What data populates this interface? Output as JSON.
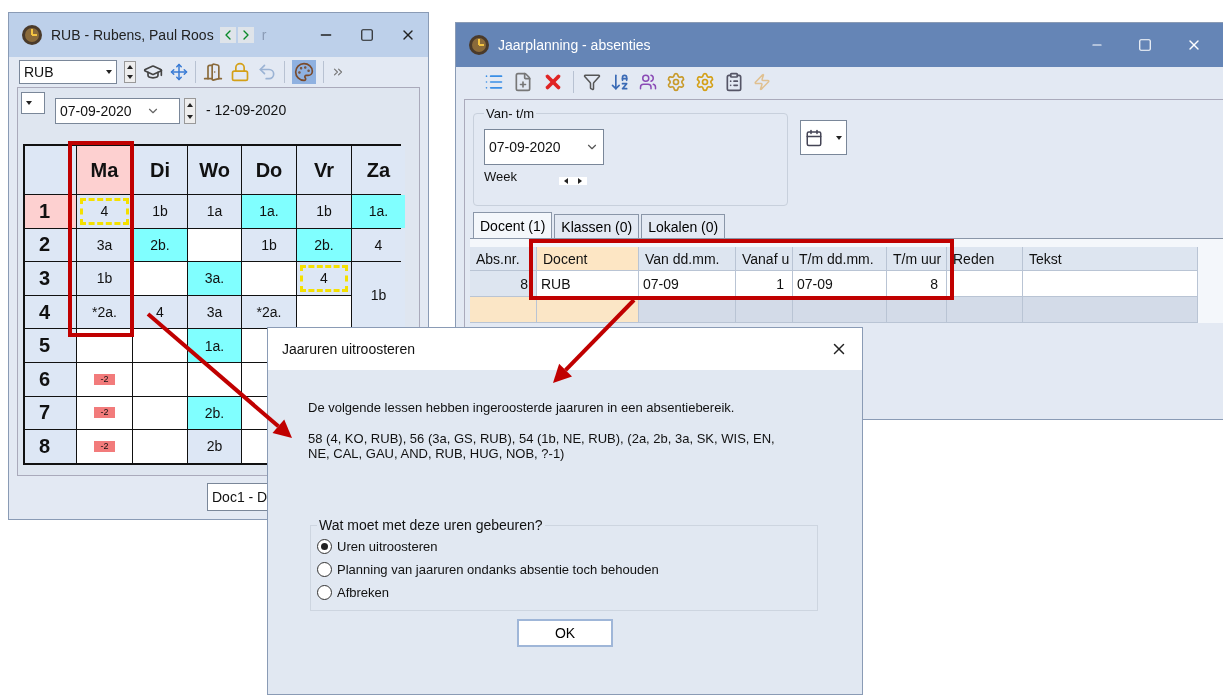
{
  "left_window": {
    "title": "RUB - Rubens, Paul  Roos",
    "title_tail": "r",
    "teacher": "RUB",
    "palette_active": true,
    "date_from": "07-09-2020",
    "date_to": "- 12-09-2020",
    "days": [
      {
        "label": "Ma",
        "selected": true
      },
      {
        "label": "Di",
        "selected": false
      },
      {
        "label": "Wo",
        "selected": false
      },
      {
        "label": "Do",
        "selected": false
      },
      {
        "label": "Vr",
        "selected": false
      },
      {
        "label": "Za",
        "selected": false
      }
    ],
    "periods": [
      {
        "label": "1",
        "selected": true,
        "cells": [
          {
            "kind": "lesson",
            "text": "4",
            "color": "#dde7f5",
            "marked": true
          },
          {
            "kind": "lesson",
            "text": "1b",
            "color": "#dde7f5",
            "marked": false
          },
          {
            "kind": "lesson",
            "text": "1a",
            "color": "#dde7f5",
            "marked": false
          },
          {
            "kind": "lesson",
            "text": "1a.",
            "color": "#80ffff",
            "marked": false
          },
          {
            "kind": "lesson",
            "text": "1b",
            "color": "#dde7f5",
            "marked": false
          },
          {
            "kind": "lesson",
            "text": "1a.",
            "color": "#80ffff",
            "marked": false
          }
        ]
      },
      {
        "label": "2",
        "selected": false,
        "cells": [
          {
            "kind": "lesson",
            "text": "3a",
            "color": "#dde7f5",
            "marked": false
          },
          {
            "kind": "lesson",
            "text": "2b.",
            "color": "#80ffff",
            "marked": false
          },
          {
            "kind": "empty",
            "marked": false
          },
          {
            "kind": "lesson",
            "text": "1b",
            "color": "#dde7f5",
            "marked": false
          },
          {
            "kind": "lesson",
            "text": "2b.",
            "color": "#80ffff",
            "marked": false
          },
          {
            "kind": "lesson",
            "text": "4",
            "color": "#dde7f5",
            "marked": false
          }
        ]
      },
      {
        "label": "3",
        "selected": false,
        "cells": [
          {
            "kind": "lesson",
            "text": "1b",
            "color": "#dde7f5",
            "marked": false
          },
          {
            "kind": "empty",
            "marked": false
          },
          {
            "kind": "lesson",
            "text": "3a.",
            "color": "#80ffff",
            "marked": false
          },
          {
            "kind": "empty",
            "marked": false
          },
          {
            "kind": "lesson",
            "text": "4",
            "color": "#dde7f5",
            "marked": true
          },
          {
            "kind": "double",
            "text": "1b",
            "color": "#dde7f5",
            "marked": false
          }
        ]
      },
      {
        "label": "4",
        "selected": false,
        "cells": [
          {
            "kind": "lesson",
            "text": "*2a.",
            "color": "#dde7f5",
            "marked": false
          },
          {
            "kind": "lesson",
            "text": "4",
            "color": "#dde7f5",
            "marked": false
          },
          {
            "kind": "lesson",
            "text": "3a",
            "color": "#dde7f5",
            "marked": false
          },
          {
            "kind": "lesson",
            "text": "*2a.",
            "color": "#dde7f5",
            "marked": false
          },
          {
            "kind": "empty",
            "marked": false
          }
        ]
      },
      {
        "label": "5",
        "selected": false,
        "cells": [
          {
            "kind": "empty",
            "marked": false
          },
          {
            "kind": "empty",
            "marked": false
          },
          {
            "kind": "lesson",
            "text": "1a.",
            "color": "#80ffff",
            "marked": false
          },
          {
            "kind": "empty",
            "marked": false
          }
        ]
      },
      {
        "label": "6",
        "selected": false,
        "cells": [
          {
            "kind": "cancel",
            "text": "-2",
            "marked": false
          },
          {
            "kind": "empty",
            "marked": false
          },
          {
            "kind": "empty",
            "marked": false
          },
          {
            "kind": "empty",
            "marked": false
          }
        ]
      },
      {
        "label": "7",
        "selected": false,
        "cells": [
          {
            "kind": "cancel",
            "text": "-2",
            "marked": false
          },
          {
            "kind": "empty",
            "marked": false
          },
          {
            "kind": "lesson",
            "text": "2b.",
            "color": "#80ffff",
            "marked": false
          },
          {
            "kind": "empty",
            "marked": false
          }
        ]
      },
      {
        "label": "8",
        "selected": false,
        "cells": [
          {
            "kind": "cancel",
            "text": "-2",
            "marked": false
          },
          {
            "kind": "empty",
            "marked": false
          },
          {
            "kind": "lesson",
            "text": "2b",
            "color": "#dde7f5",
            "marked": false
          },
          {
            "kind": "empty",
            "marked": false
          }
        ]
      }
    ],
    "footer_field": "Doc1 - D"
  },
  "right_window": {
    "title": "Jaarplanning - absenties",
    "range_group": "Van- t/m",
    "date": "07-09-2020",
    "week_label": "Week",
    "tabs": [
      {
        "label": "Docent (1)",
        "selected": true
      },
      {
        "label": "Klassen (0)",
        "selected": false
      },
      {
        "label": "Lokalen (0)",
        "selected": false
      }
    ],
    "columns": [
      {
        "label": "Abs.nr.",
        "numeric": true,
        "selected": false
      },
      {
        "label": "Docent",
        "numeric": false,
        "selected": true
      },
      {
        "label": "Van dd.mm.",
        "numeric": false,
        "selected": false
      },
      {
        "label": "Vanaf u",
        "numeric": true,
        "selected": false
      },
      {
        "label": "T/m dd.mm.",
        "numeric": false,
        "selected": false
      },
      {
        "label": "T/m uur",
        "numeric": true,
        "selected": false
      },
      {
        "label": "Reden",
        "selected": false
      },
      {
        "label": "Tekst",
        "selected": false
      }
    ],
    "rows": [
      {
        "kind": "data",
        "cells": [
          "8",
          "RUB",
          "07-09",
          "1",
          "07-09",
          "8"
        ]
      },
      {
        "kind": "new"
      }
    ]
  },
  "dialog": {
    "title": "Jaaruren uitroosteren",
    "message": "De volgende lessen hebben ingeroosterde jaaruren in een absentiebereik.",
    "lessons": "58 (4, KO, RUB), 56 (3a, GS, RUB), 54 (1b, NE, RUB),  (2a, 2b, 3a, SK, WIS, EN, NE, CAL, GAU, AND, RUB, HUG, NOB, ?-1)",
    "question": "Wat moet met deze uren gebeuren?",
    "options": [
      {
        "label": "Uren uitroosteren",
        "selected": true
      },
      {
        "label": "Planning van jaaruren ondanks absentie toch behouden",
        "selected": false
      },
      {
        "label": "Afbreken",
        "selected": false
      }
    ],
    "ok": "OK"
  }
}
